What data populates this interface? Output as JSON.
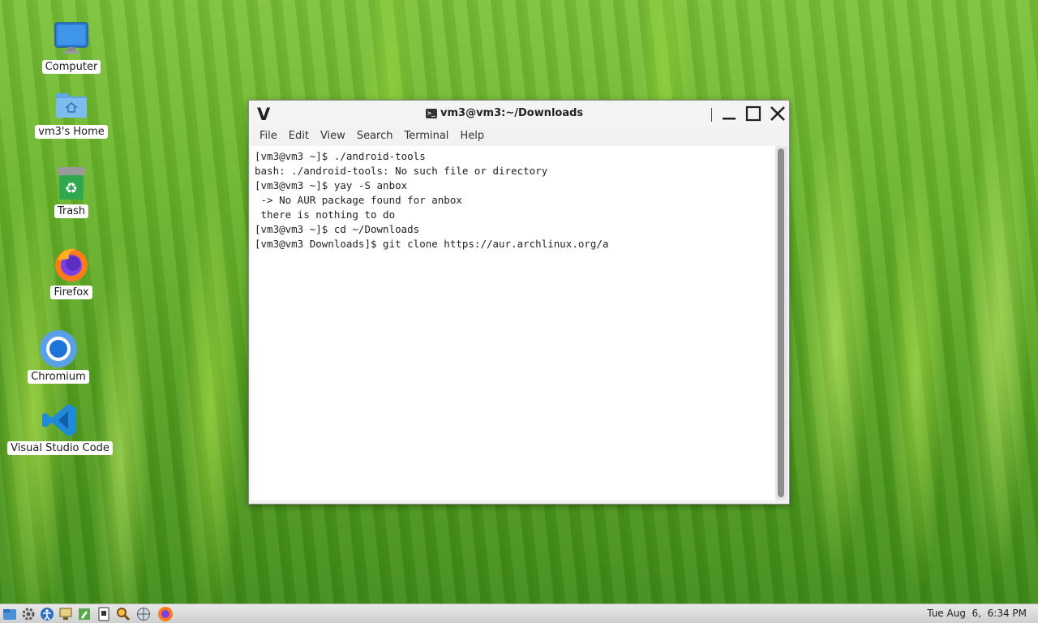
{
  "desktop": {
    "icons": [
      {
        "label": "Computer",
        "icon": "computer-icon"
      },
      {
        "label": "vm3's Home",
        "icon": "home-folder-icon"
      },
      {
        "label": "Trash",
        "icon": "trash-icon"
      },
      {
        "label": "Firefox",
        "icon": "firefox-icon"
      },
      {
        "label": "Chromium",
        "icon": "chromium-icon"
      },
      {
        "label": "Visual Studio Code",
        "icon": "vscode-icon"
      }
    ]
  },
  "window": {
    "logo": "V",
    "title": "vm3@vm3:~/Downloads",
    "controls": [
      "minimize-icon",
      "maximize-icon",
      "close-icon"
    ]
  },
  "menu": [
    "File",
    "Edit",
    "View",
    "Search",
    "Terminal",
    "Help"
  ],
  "terminal": {
    "lines": [
      "[vm3@vm3 ~]$ ./android-tools",
      "bash: ./android-tools: No such file or directory",
      "[vm3@vm3 ~]$ yay -S anbox",
      " -> No AUR package found for anbox",
      " there is nothing to do",
      "[vm3@vm3 ~]$ cd ~/Downloads",
      "[vm3@vm3 Downloads]$ git clone https://aur.archlinux.org/a"
    ]
  },
  "taskbar": {
    "launchers": [
      "app-menu-icon",
      "settings-icon",
      "accessibility-icon",
      "monitor-icon",
      "editor-icon",
      "terminal-icon",
      "search-icon",
      "network-icon",
      "firefox-icon"
    ],
    "clock": "Tue Aug  6,  6:34 PM"
  },
  "colors": {
    "accent_blue": "#4a90d9",
    "terminal_bg": "#ffffff",
    "window_chrome": "#f2f2f2"
  }
}
